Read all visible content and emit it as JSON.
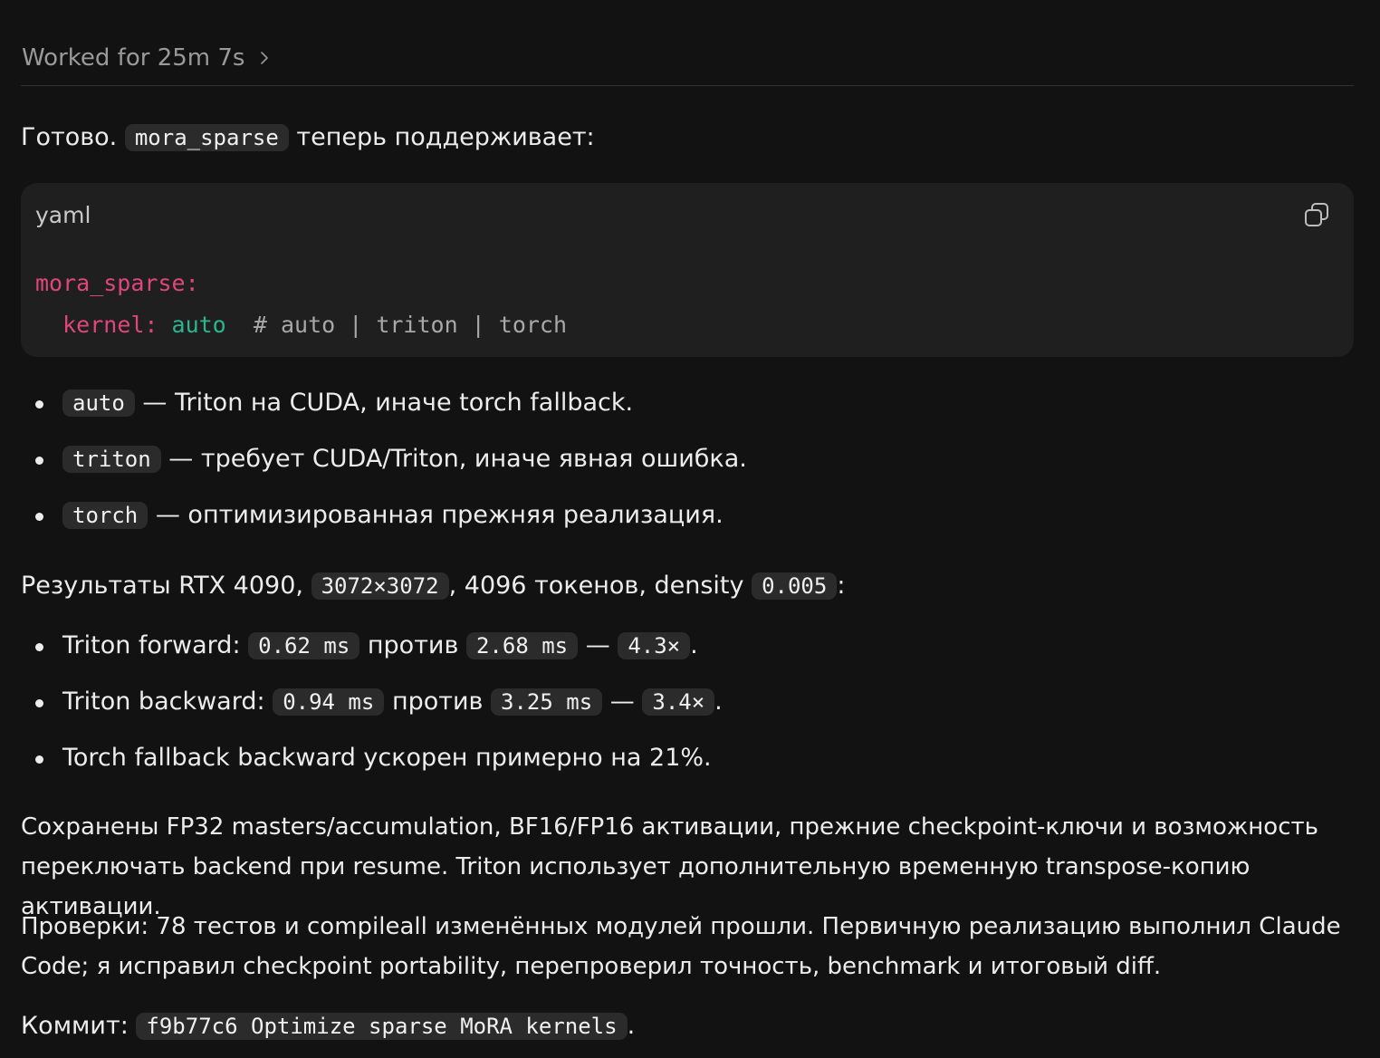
{
  "header": {
    "worked_label": "Worked for 25m 7s"
  },
  "intro": {
    "prefix": "Готово.",
    "code": "mora_sparse",
    "suffix": "теперь поддерживает:"
  },
  "code_block": {
    "language": "yaml",
    "line1_key": "mora_sparse:",
    "line2_key": "kernel:",
    "line2_value": "auto",
    "line2_comment": "# auto | triton | torch"
  },
  "modes": [
    {
      "code": "auto",
      "text": "— Triton на CUDA, иначе torch fallback."
    },
    {
      "code": "triton",
      "text": "— требует CUDA/Triton, иначе явная ошибка."
    },
    {
      "code": "torch",
      "text": "— оптимизированная прежняя реализация."
    }
  ],
  "results": {
    "prefix": "Результаты RTX 4090,",
    "size_code": "3072×3072",
    "middle": ", 4096 токенов, density",
    "density_code": "0.005",
    "suffix": ":"
  },
  "benchmarks": {
    "forward": {
      "label": "Triton forward:",
      "new": "0.62 ms",
      "vs": "против",
      "old": "2.68 ms",
      "dash": "—",
      "speedup": "4.3×",
      "end": "."
    },
    "backward": {
      "label": "Triton backward:",
      "new": "0.94 ms",
      "vs": "против",
      "old": "3.25 ms",
      "dash": "—",
      "speedup": "3.4×",
      "end": "."
    },
    "fallback": "Torch fallback backward ускорен примерно на 21%."
  },
  "paragraph1": "Сохранены FP32 masters/accumulation, BF16/FP16 активации, прежние checkpoint-ключи и возможность переключать backend при resume. Triton использует дополнительную временную transpose-копию активации.",
  "paragraph2": "Проверки: 78 тестов и compileall изменённых модулей прошли. Первичную реализацию выполнил Claude Code; я исправил checkpoint portability, перепроверил точность, benchmark и итоговый diff.",
  "commit": {
    "label": "Коммит:",
    "code": "f9b77c6 Optimize sparse MoRA kernels",
    "end": "."
  }
}
